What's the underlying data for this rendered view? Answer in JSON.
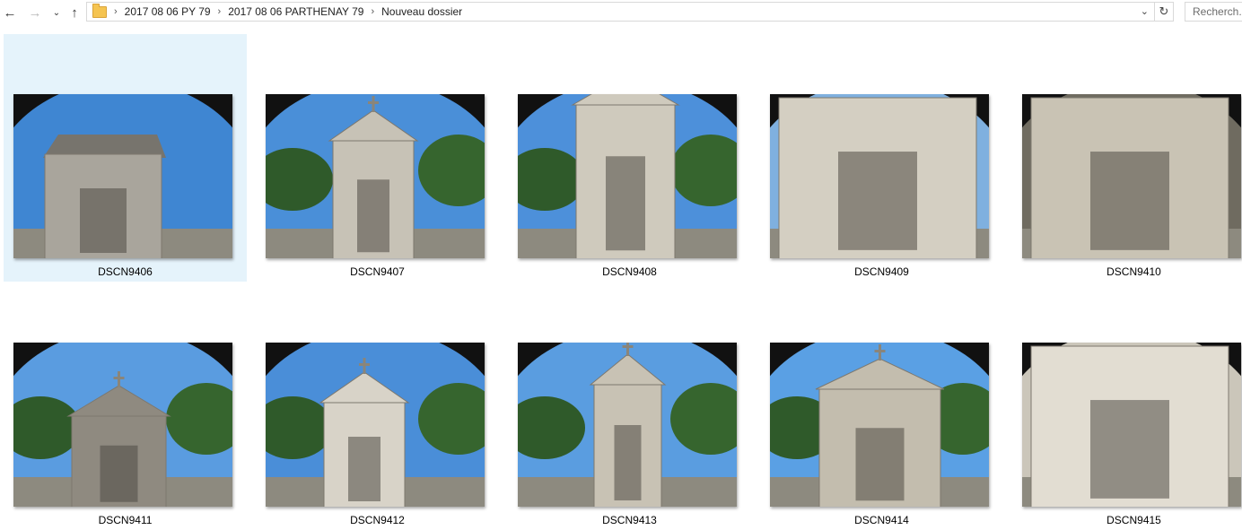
{
  "navigation": {
    "back_icon": "arrow-left-icon",
    "forward_icon": "arrow-right-icon",
    "recent_icon": "chevron-down-icon",
    "up_icon": "arrow-up-icon",
    "breadcrumbs": [
      "2017 08 06 PY 79",
      "2017 08 06 PARTHENAY 79",
      "Nouveau dossier"
    ],
    "search_placeholder": "Recherch..."
  },
  "colors": {
    "selection": "#e5f3fb",
    "sky": "#3f86d2",
    "stone": "#b9b3a7"
  },
  "files": [
    {
      "name": "DSCN9406",
      "selected": true
    },
    {
      "name": "DSCN9407",
      "selected": false
    },
    {
      "name": "DSCN9408",
      "selected": false
    },
    {
      "name": "DSCN9409",
      "selected": false
    },
    {
      "name": "DSCN9410",
      "selected": false
    },
    {
      "name": "DSCN9411",
      "selected": false
    },
    {
      "name": "DSCN9412",
      "selected": false
    },
    {
      "name": "DSCN9413",
      "selected": false
    },
    {
      "name": "DSCN9414",
      "selected": false
    },
    {
      "name": "DSCN9415",
      "selected": false
    }
  ]
}
